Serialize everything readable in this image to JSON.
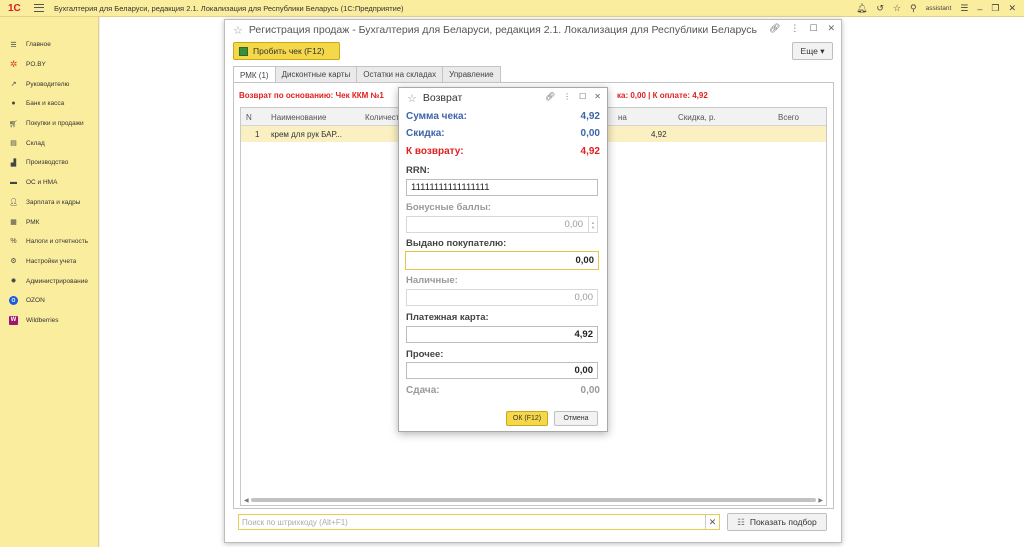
{
  "app": {
    "logo": "1С",
    "title": "Бухгалтерия для Беларуси, редакция 2.1. Локализация для Республики Беларусь   (1С:Предприятие)",
    "user": "assistant"
  },
  "sidebar": {
    "items": [
      {
        "label": "Главное",
        "icon": "menu-icon"
      },
      {
        "label": "PO.BY",
        "icon": "po-icon"
      },
      {
        "label": "Руководителю",
        "icon": "chart-icon"
      },
      {
        "label": "Банк и касса",
        "icon": "bank-icon"
      },
      {
        "label": "Покупки и продажи",
        "icon": "cart-icon"
      },
      {
        "label": "Склад",
        "icon": "warehouse-icon"
      },
      {
        "label": "Производство",
        "icon": "factory-icon"
      },
      {
        "label": "ОС и НМА",
        "icon": "truck-icon"
      },
      {
        "label": "Зарплата и кадры",
        "icon": "person-icon"
      },
      {
        "label": "РМК",
        "icon": "register-icon"
      },
      {
        "label": "Налоги и отчетность",
        "icon": "tax-icon"
      },
      {
        "label": "Настройки учета",
        "icon": "settings-icon"
      },
      {
        "label": "Администрирование",
        "icon": "gear-icon"
      },
      {
        "label": "OZON",
        "icon": "ozon-icon"
      },
      {
        "label": "Wildberries",
        "icon": "wb-icon"
      }
    ]
  },
  "mainwin": {
    "title": "Регистрация продаж - Бухгалтерия для Беларуси, редакция 2.1. Локализация для Республики Беларусь",
    "probit_label": "Пробить чек (F12)",
    "more_label": "Еще ▾",
    "tabs": [
      "РМК (1)",
      "Дисконтные карты",
      "Остатки на складах",
      "Управление"
    ],
    "return_basis": "Возврат по основанию: Чек ККМ №1",
    "totals_line": "ка: 0,00 | К оплате: 4,92",
    "columns": [
      "N",
      "Наименование",
      "Количест",
      "на",
      "Скидка, р.",
      "Всего"
    ],
    "rows": [
      {
        "n": "1",
        "name": "крем для рук БАР...",
        "price": "4,92"
      }
    ],
    "search_placeholder": "Поиск по штрихкоду (Alt+F1)",
    "podbor_label": "Показать подбор"
  },
  "dialog": {
    "title": "Возврат",
    "sum_label": "Сумма чека:",
    "sum_value": "4,92",
    "discount_label": "Скидка:",
    "discount_value": "0,00",
    "refund_label": "К возврату:",
    "refund_value": "4,92",
    "rrn_label": "RRN:",
    "rrn_value": "11111111111111111",
    "bonus_label": "Бонусные баллы:",
    "bonus_value": "0,00",
    "issued_label": "Выдано покупателю:",
    "issued_value": "0,00",
    "cash_label": "Наличные:",
    "cash_value": "0,00",
    "card_label": "Платежная карта:",
    "card_value": "4,92",
    "other_label": "Прочее:",
    "other_value": "0,00",
    "change_label": "Сдача:",
    "change_value": "0,00",
    "ok_label": "ОК (F12)",
    "cancel_label": "Отмена"
  },
  "colors": {
    "accent_yellow": "#f5d84a",
    "panel_yellow": "#fbed9e",
    "label_blue": "#3d65a8",
    "alert_red": "#e02020"
  }
}
